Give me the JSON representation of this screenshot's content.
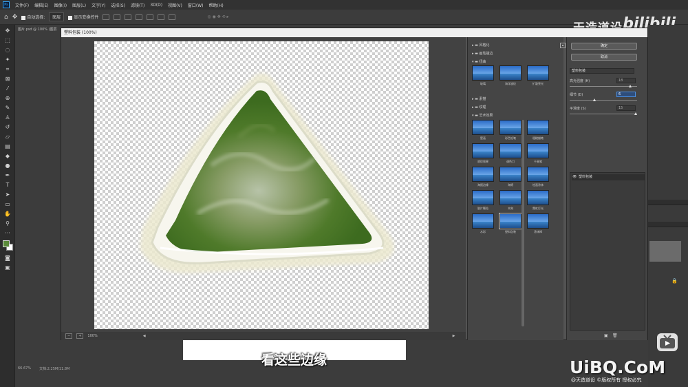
{
  "app": {
    "name": "Ps"
  },
  "menubar": [
    "文件(F)",
    "编辑(E)",
    "图像(I)",
    "图层(L)",
    "文字(Y)",
    "选择(S)",
    "滤镜(T)",
    "3D(D)",
    "视图(V)",
    "窗口(W)",
    "帮助(H)"
  ],
  "optionsbar": {
    "auto_select": "自动选择:",
    "auto_select_value": "图层",
    "show_transform": "显示变换控件"
  },
  "watermark": {
    "top_text": "天造道设",
    "bili": "bilibili"
  },
  "document": {
    "tab": "图片.psd @ 100% (图层",
    "zoom": "66.67%",
    "doc_info": "文档:2.25M/11.8M"
  },
  "dialog": {
    "title": "塑料包装 (100%)",
    "preview_zoom": "100%",
    "ok_label": "确定",
    "cancel_label": "取消",
    "filter_select": "塑料包装",
    "params": [
      {
        "label": "高光强度 (H)",
        "value": "18",
        "fraction": 0.9
      },
      {
        "label": "细节 (D)",
        "value": "6",
        "fraction": 0.35,
        "active": true
      },
      {
        "label": "平滑度 (S)",
        "value": "15",
        "fraction": 0.98
      }
    ],
    "applied_layer": "塑料包装",
    "folders": [
      {
        "name": "风格化",
        "open": false
      },
      {
        "name": "画笔描边",
        "open": false
      },
      {
        "name": "扭曲",
        "open": true
      },
      {
        "name": "素描",
        "open": false
      },
      {
        "name": "纹理",
        "open": false
      },
      {
        "name": "艺术效果",
        "open": true
      }
    ],
    "distort_thumbs": [
      "玻璃",
      "海洋波纹",
      "扩散亮光"
    ],
    "artistic_thumbs": [
      "壁画",
      "彩色铅笔",
      "粗糙蜡笔",
      "底纹效果",
      "调色刀",
      "干画笔",
      "海报边缘",
      "海绵",
      "绘画涂抹",
      "胶片颗粒",
      "木刻",
      "霓虹灯光",
      "水彩",
      "塑料包装",
      "涂抹棒"
    ],
    "selected_thumb": "塑料包装"
  },
  "subtitle": "看这些边缘",
  "site_watermark": "UiBQ.CoM",
  "credit": "@天造道设 ©版权所有 授权必究"
}
